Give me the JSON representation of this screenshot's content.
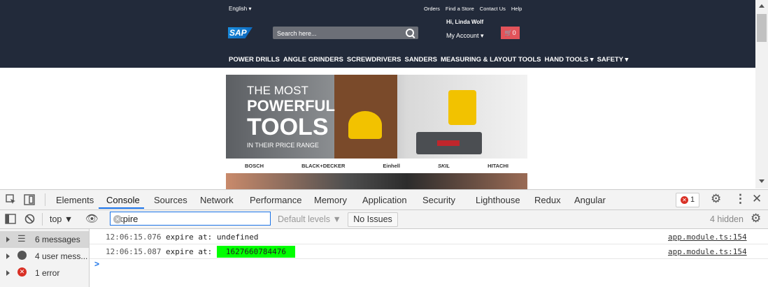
{
  "site": {
    "language": "English",
    "top_links": [
      "Orders",
      "Find a Store",
      "Contact Us",
      "Help"
    ],
    "logo_text": "SAP",
    "search_placeholder": "Search here...",
    "greeting": "Hi, Linda Wolf",
    "account_label": "My Account",
    "cart_count": "0",
    "nav_items": [
      "POWER DRILLS",
      "ANGLE GRINDERS",
      "SCREWDRIVERS",
      "SANDERS",
      "MEASURING & LAYOUT TOOLS",
      "HAND TOOLS",
      "SAFETY"
    ],
    "banner": {
      "line1": "THE MOST",
      "line2": "POWERFUL",
      "line3": "TOOLS",
      "line4": "IN THEIR PRICE RANGE"
    },
    "brands": [
      "BOSCH",
      "BLACK+DECKER",
      "Einhell",
      "SKIL",
      "HITACHI"
    ]
  },
  "devtools": {
    "tabs": [
      "Elements",
      "Console",
      "Sources",
      "Network",
      "Performance",
      "Memory",
      "Application",
      "Security",
      "Lighthouse",
      "Redux",
      "Angular"
    ],
    "active_tab": "Console",
    "error_badge": "1",
    "context": "top",
    "filter_value": "expire",
    "levels": "Default levels",
    "issues_label": "No Issues",
    "hidden_count": "4 hidden",
    "sidebar": [
      "6 messages",
      "4 user mess...",
      "1 error"
    ],
    "logs": [
      {
        "time": "12:06:15.076",
        "text": "expire at:",
        "value": "undefined",
        "source": "app.module.ts:154"
      },
      {
        "time": "12:06:15.087",
        "text": "expire at:",
        "value": "1627660784476",
        "source": "app.module.ts:154"
      }
    ],
    "prompt": ">"
  },
  "colors": {
    "header_bg": "#222a3a",
    "cart_bg": "#e2535a",
    "highlight": "#00ff00",
    "accent": "#1a73e8"
  }
}
